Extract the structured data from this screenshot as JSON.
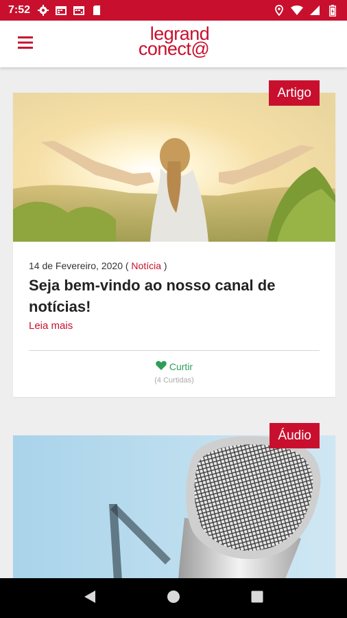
{
  "status_bar": {
    "time": "7:52",
    "left_icons": [
      "gear-icon",
      "calendar-icon",
      "calendar-icon",
      "sd-card-icon"
    ],
    "right_icons": [
      "location-icon",
      "wifi-icon",
      "signal-icon",
      "battery-icon"
    ]
  },
  "app_bar": {
    "logo_line1": "legrand",
    "logo_line2": "conect@",
    "brand_color": "#c8102e"
  },
  "cards": [
    {
      "badge": "Artigo",
      "date": "14 de Fevereiro, 2020 (",
      "category": "Notícia",
      "category_close": ")",
      "title": "Seja bem-vindo ao nosso canal de notícias!",
      "read_more": "Leia mais",
      "like_label": "Curtir",
      "likes_count": "(4 Curtidas)"
    },
    {
      "badge": "Áudio"
    }
  ],
  "colors": {
    "accent": "#c8102e",
    "like_green": "#2e9e57",
    "background": "#eeeeee"
  }
}
